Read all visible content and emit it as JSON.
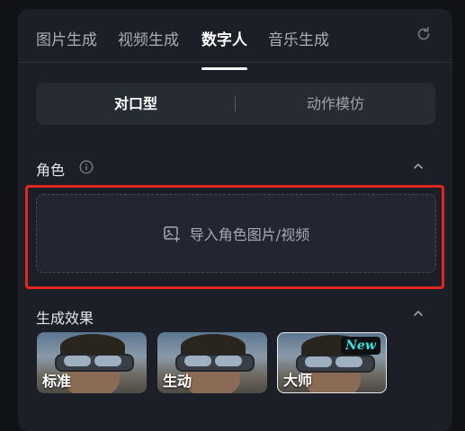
{
  "tabs": [
    {
      "label": "图片生成",
      "active": false
    },
    {
      "label": "视频生成",
      "active": false
    },
    {
      "label": "数字人",
      "active": true
    },
    {
      "label": "音乐生成",
      "active": false
    }
  ],
  "mode_toggle": {
    "options": [
      "对口型",
      "动作模仿"
    ],
    "selected": "对口型"
  },
  "role_section": {
    "title": "角色",
    "upload_label": "导入角色图片/视频"
  },
  "effect_section": {
    "title": "生成效果",
    "options": [
      {
        "label": "标准",
        "selected": false
      },
      {
        "label": "生动",
        "selected": false
      },
      {
        "label": "大师",
        "selected": true,
        "badge": "New"
      }
    ]
  },
  "icons": {
    "reset": "reset-icon",
    "info": "info-icon",
    "collapse": "chevron-up-icon",
    "upload": "image-add-icon"
  },
  "colors": {
    "highlight_border": "#e0261d",
    "new_badge_text": "#36e3e0"
  }
}
